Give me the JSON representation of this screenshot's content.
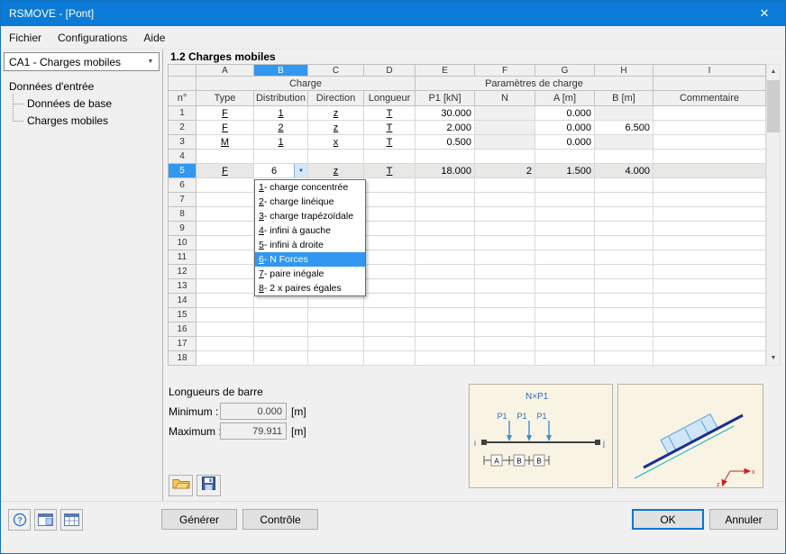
{
  "window": {
    "title": "RSMOVE - [Pont]"
  },
  "icons": {
    "close": "✕",
    "chevron_down": "▼",
    "scroll_up": "▲",
    "scroll_down": "▼",
    "help": "?"
  },
  "menu": {
    "items": [
      "Fichier",
      "Configurations",
      "Aide"
    ]
  },
  "sidebar": {
    "combo_value": "CA1 - Charges mobiles",
    "tree": {
      "root": "Données d'entrée",
      "children": [
        "Données de base",
        "Charges mobiles"
      ]
    }
  },
  "section": {
    "title": "1.2 Charges mobiles"
  },
  "table": {
    "col_letters": [
      "A",
      "B",
      "C",
      "D",
      "E",
      "F",
      "G",
      "H",
      "I"
    ],
    "current_col": "B",
    "current_row": "5",
    "group_charge": "Charge",
    "group_params": "Paramètres de charge",
    "col_headers": [
      "n°",
      "Type",
      "Distribution",
      "Direction",
      "Longueur",
      "P1 [kN]",
      "N",
      "A [m]",
      "B [m]",
      "Commentaire"
    ],
    "rows": [
      {
        "n": "1",
        "cells": [
          {
            "v": "F",
            "link": true
          },
          {
            "v": "1",
            "link": true
          },
          {
            "v": "z",
            "link": true
          },
          {
            "v": "T",
            "link": true
          },
          "30.000",
          {
            "v": "",
            "muted": true
          },
          "0.000",
          {
            "v": "",
            "muted": true
          },
          ""
        ]
      },
      {
        "n": "2",
        "cells": [
          {
            "v": "F",
            "link": true
          },
          {
            "v": "2",
            "link": true
          },
          {
            "v": "z",
            "link": true
          },
          {
            "v": "T",
            "link": true
          },
          "2.000",
          {
            "v": "",
            "muted": true
          },
          "0.000",
          "6.500",
          ""
        ]
      },
      {
        "n": "3",
        "cells": [
          {
            "v": "M",
            "link": true
          },
          {
            "v": "1",
            "link": true
          },
          {
            "v": "x",
            "link": true
          },
          {
            "v": "T",
            "link": true
          },
          "0.500",
          {
            "v": "",
            "muted": true
          },
          "0.000",
          {
            "v": "",
            "muted": true
          },
          ""
        ]
      },
      {
        "n": "4",
        "cells": [
          "",
          "",
          "",
          "",
          "",
          "",
          "",
          "",
          ""
        ]
      },
      {
        "n": "5",
        "selected": true,
        "cells": [
          {
            "v": "F",
            "link": true
          },
          {
            "v": "6",
            "combo": true
          },
          {
            "v": "z",
            "link": true
          },
          {
            "v": "T",
            "link": true
          },
          "18.000",
          "2",
          "1.500",
          "4.000",
          ""
        ]
      },
      {
        "n": "6",
        "cells": [
          "",
          "",
          "",
          "",
          "",
          "",
          "",
          "",
          ""
        ]
      },
      {
        "n": "7",
        "cells": [
          "",
          "",
          "",
          "",
          "",
          "",
          "",
          "",
          ""
        ]
      },
      {
        "n": "8",
        "cells": [
          "",
          "",
          "",
          "",
          "",
          "",
          "",
          "",
          ""
        ]
      },
      {
        "n": "9",
        "cells": [
          "",
          "",
          "",
          "",
          "",
          "",
          "",
          "",
          ""
        ]
      },
      {
        "n": "10",
        "cells": [
          "",
          "",
          "",
          "",
          "",
          "",
          "",
          "",
          ""
        ]
      },
      {
        "n": "11",
        "cells": [
          "",
          "",
          "",
          "",
          "",
          "",
          "",
          "",
          ""
        ]
      },
      {
        "n": "12",
        "cells": [
          "",
          "",
          "",
          "",
          "",
          "",
          "",
          "",
          ""
        ]
      },
      {
        "n": "13",
        "cells": [
          "",
          "",
          "",
          "",
          "",
          "",
          "",
          "",
          ""
        ]
      },
      {
        "n": "14",
        "cells": [
          "",
          "",
          "",
          "",
          "",
          "",
          "",
          "",
          ""
        ]
      },
      {
        "n": "15",
        "cells": [
          "",
          "",
          "",
          "",
          "",
          "",
          "",
          "",
          ""
        ]
      },
      {
        "n": "16",
        "cells": [
          "",
          "",
          "",
          "",
          "",
          "",
          "",
          "",
          ""
        ]
      },
      {
        "n": "17",
        "cells": [
          "",
          "",
          "",
          "",
          "",
          "",
          "",
          "",
          ""
        ]
      },
      {
        "n": "18",
        "cells": [
          "",
          "",
          "",
          "",
          "",
          "",
          "",
          "",
          ""
        ]
      }
    ]
  },
  "dropdown": {
    "selected_index": 5,
    "items": [
      "1 - charge concentrée",
      "2 - charge linéique",
      "3 - charge trapézoïdale",
      "4 - infini à gauche",
      "5 - infini à droite",
      "6 - N Forces",
      "7 - paire inégale",
      "8 - 2 x paires égales"
    ]
  },
  "lengths": {
    "title": "Longueurs de barre",
    "min_label": "Minimum :",
    "min_value": "0.000",
    "max_label": "Maximum :",
    "max_value": "79.911",
    "unit": "[m]"
  },
  "diagram": {
    "formula": "N×P1",
    "p_label": "P1",
    "node_i": "i",
    "node_j": "j",
    "dims": [
      "A",
      "B",
      "B"
    ],
    "axis_x": "x",
    "axis_z": "z"
  },
  "buttons": {
    "generate": "Générer",
    "control": "Contrôle",
    "ok": "OK",
    "cancel": "Annuler"
  }
}
